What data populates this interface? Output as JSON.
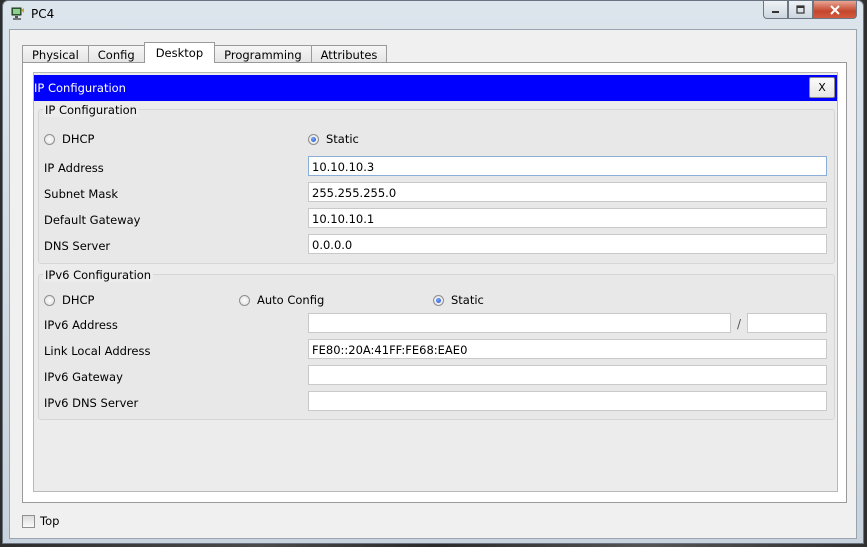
{
  "window": {
    "title": "PC4",
    "icon": "pc-icon",
    "controls": {
      "minimize": "minimize-icon",
      "maximize": "maximize-icon",
      "close": "close-icon"
    }
  },
  "tabs": [
    {
      "label": "Physical"
    },
    {
      "label": "Config"
    },
    {
      "label": "Desktop",
      "active": true
    },
    {
      "label": "Programming"
    },
    {
      "label": "Attributes"
    }
  ],
  "dialog": {
    "title": "IP Configuration",
    "close_label": "X",
    "title_bar_color": "#0000ff"
  },
  "ipv4": {
    "group_title": "IP Configuration",
    "mode": {
      "dhcp_label": "DHCP",
      "static_label": "Static",
      "selected": "Static"
    },
    "ip_address": {
      "label": "IP Address",
      "value": "10.10.10.3"
    },
    "subnet_mask": {
      "label": "Subnet Mask",
      "value": "255.255.255.0"
    },
    "default_gateway": {
      "label": "Default Gateway",
      "value": "10.10.10.1"
    },
    "dns_server": {
      "label": "DNS Server",
      "value": "0.0.0.0"
    }
  },
  "ipv6": {
    "group_title": "IPv6 Configuration",
    "mode": {
      "dhcp_label": "DHCP",
      "auto_label": "Auto Config",
      "static_label": "Static",
      "selected": "Static"
    },
    "address": {
      "label": "IPv6 Address",
      "value": "",
      "prefix": "",
      "separator": "/"
    },
    "link_local": {
      "label": "Link Local Address",
      "value": "FE80::20A:41FF:FE68:EAE0"
    },
    "gateway": {
      "label": "IPv6 Gateway",
      "value": ""
    },
    "dns_server": {
      "label": "IPv6 DNS Server",
      "value": ""
    }
  },
  "footer": {
    "top_label": "Top",
    "top_checked": false
  }
}
